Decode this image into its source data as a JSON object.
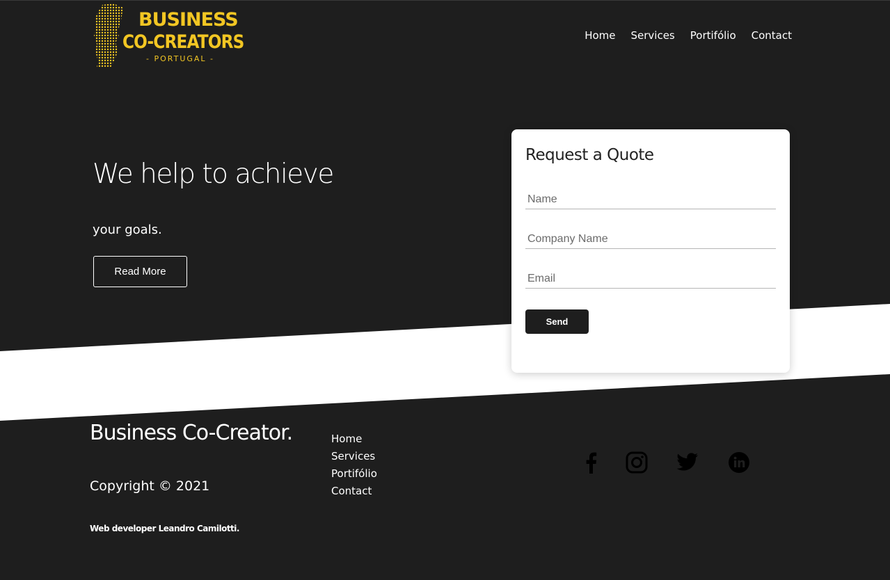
{
  "brand": {
    "logo_line1": "BUSINESS",
    "logo_line2": "CO-CREATORS",
    "logo_line3": "- PORTUGAL -",
    "accent_color": "#f2c623"
  },
  "nav": {
    "items": [
      {
        "label": "Home"
      },
      {
        "label": "Services"
      },
      {
        "label": "Portifólio"
      },
      {
        "label": "Contact"
      }
    ]
  },
  "hero": {
    "title": "We help to achieve",
    "subtitle": "your goals.",
    "cta_label": "Read More"
  },
  "quote_form": {
    "title": "Request a Quote",
    "name_placeholder": "Name",
    "company_placeholder": "Company Name",
    "email_placeholder": "Email",
    "send_label": "Send"
  },
  "footer": {
    "brand": "Business Co-Creator.",
    "copyright": "Copyright © 2021",
    "developer": "Web developer Leandro Camilotti.",
    "links": [
      {
        "label": "Home"
      },
      {
        "label": "Services"
      },
      {
        "label": "Portifólio"
      },
      {
        "label": "Contact"
      }
    ],
    "social_icons": [
      "facebook-icon",
      "instagram-icon",
      "twitter-icon",
      "linkedin-icon"
    ]
  },
  "colors": {
    "background": "#1e1e1e",
    "band": "#ffffff"
  }
}
